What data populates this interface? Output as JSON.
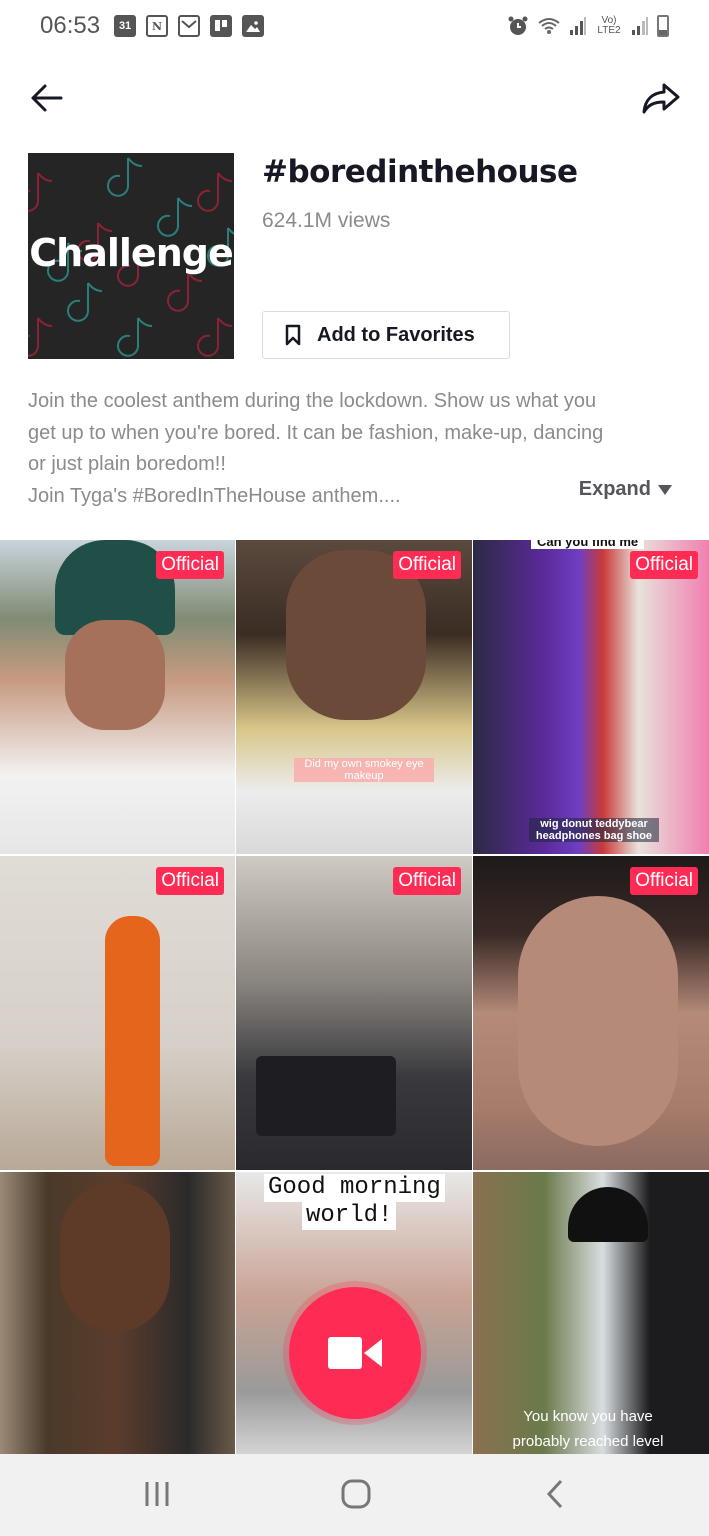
{
  "status_bar": {
    "time": "06:53",
    "left_icons": [
      "calendar-icon",
      "notion-icon",
      "gmail-icon",
      "trello-icon",
      "gallery-icon"
    ],
    "calendar_day": "31",
    "notion_letter": "N",
    "right_icons": [
      "alarm-icon",
      "wifi-icon",
      "signal-icon",
      "volte-icon",
      "signal-icon",
      "battery-icon"
    ],
    "volte_label": "Vo) LTE2"
  },
  "top_nav": {
    "back_icon": "arrow-left-icon",
    "share_icon": "share-icon"
  },
  "challenge": {
    "cover_label": "Challenge",
    "title": "#boredinthehouse",
    "views": "624.1M views",
    "favorite_label": "Add to Favorites",
    "description_lines": [
      "Join the coolest anthem during the lockdown. Show us what you",
      "get up to when you're bored. It can be fashion, make-up, dancing",
      "or just plain boredom!!",
      "Join Tyga's #BoredInTheHouse anthem...."
    ],
    "expand_label": "Expand"
  },
  "colors": {
    "accent": "#fe2c55",
    "text_primary": "#161823",
    "text_secondary": "#8a8b91"
  },
  "videos": [
    {
      "badge": "Official",
      "caption": ""
    },
    {
      "badge": "Official",
      "caption": "Did my own smokey eye makeup"
    },
    {
      "badge": "Official",
      "top_caption": "Can you find me",
      "caption": "wig  donut  teddybear headphones  bag  shoe"
    },
    {
      "badge": "Official",
      "caption": ""
    },
    {
      "badge": "Official",
      "caption": ""
    },
    {
      "badge": "Official",
      "caption": ""
    },
    {
      "badge": "",
      "caption": ""
    },
    {
      "badge": "",
      "top_caption_line1": "Good morning",
      "top_caption_line2": "world!"
    },
    {
      "badge": "",
      "caption": "You know you have probably reached level"
    }
  ],
  "record_button": {
    "icon": "video-camera-icon"
  },
  "system_nav": {
    "recents_icon": "recents-icon",
    "home_icon": "home-icon",
    "back_icon": "back-chevron-icon"
  }
}
